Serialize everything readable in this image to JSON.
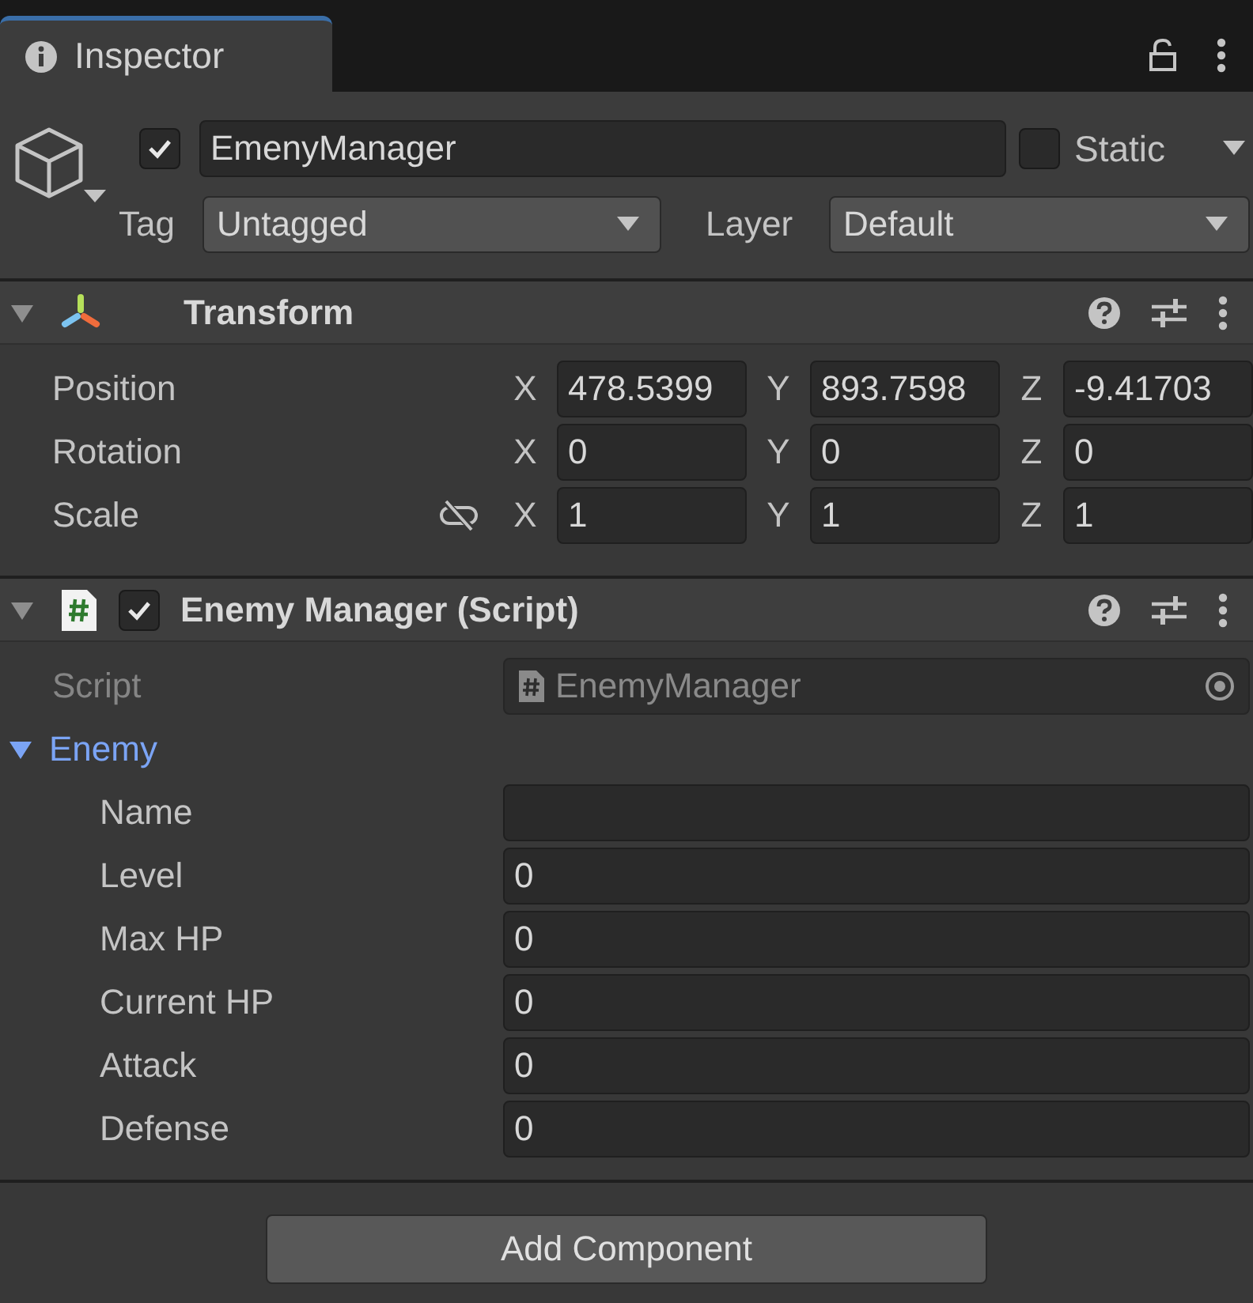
{
  "tab": {
    "title": "Inspector"
  },
  "object": {
    "active": true,
    "name": "EmenyManager",
    "static": false,
    "static_label": "Static",
    "tag_label": "Tag",
    "tag": "Untagged",
    "layer_label": "Layer",
    "layer": "Default"
  },
  "components": [
    {
      "kind": "transform",
      "title": "Transform",
      "expanded": true,
      "rows": [
        {
          "label": "Position",
          "axes": [
            {
              "axis": "X",
              "value": "478.5399"
            },
            {
              "axis": "Y",
              "value": "893.7598"
            },
            {
              "axis": "Z",
              "value": "-9.41703"
            }
          ]
        },
        {
          "label": "Rotation",
          "axes": [
            {
              "axis": "X",
              "value": "0"
            },
            {
              "axis": "Y",
              "value": "0"
            },
            {
              "axis": "Z",
              "value": "0"
            }
          ]
        },
        {
          "label": "Scale",
          "constrained": false,
          "axes": [
            {
              "axis": "X",
              "value": "1"
            },
            {
              "axis": "Y",
              "value": "1"
            },
            {
              "axis": "Z",
              "value": "1"
            }
          ]
        }
      ]
    },
    {
      "kind": "script",
      "title": "Enemy Manager (Script)",
      "enabled": true,
      "expanded": true,
      "script_label": "Script",
      "script": "EnemyManager",
      "script_disabled": true,
      "groups": [
        {
          "label": "Enemy",
          "expanded": true,
          "fields": [
            {
              "label": "Name"
            },
            {
              "label": "Level",
              "value": "0"
            },
            {
              "label": "Max HP",
              "value": "0"
            },
            {
              "label": "Current HP",
              "value": "0"
            },
            {
              "label": "Attack",
              "value": "0"
            },
            {
              "label": "Defense",
              "value": "0"
            }
          ]
        }
      ]
    }
  ],
  "add_button": "Add Component"
}
